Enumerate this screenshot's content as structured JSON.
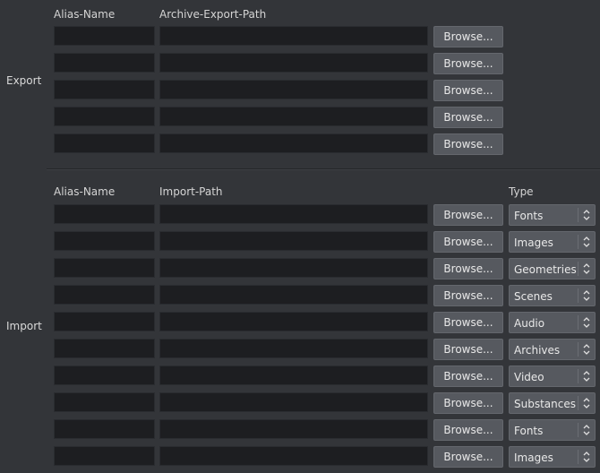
{
  "export": {
    "section_label": "Export",
    "headers": {
      "alias": "Alias-Name",
      "path": "Archive-Export-Path"
    },
    "rows": [
      {
        "alias": "",
        "path": "",
        "browse_label": "Browse..."
      },
      {
        "alias": "",
        "path": "",
        "browse_label": "Browse..."
      },
      {
        "alias": "",
        "path": "",
        "browse_label": "Browse..."
      },
      {
        "alias": "",
        "path": "",
        "browse_label": "Browse..."
      },
      {
        "alias": "",
        "path": "",
        "browse_label": "Browse..."
      }
    ]
  },
  "import": {
    "section_label": "Import",
    "headers": {
      "alias": "Alias-Name",
      "path": "Import-Path",
      "type": "Type"
    },
    "rows": [
      {
        "alias": "",
        "path": "",
        "browse_label": "Browse...",
        "type": "Fonts"
      },
      {
        "alias": "",
        "path": "",
        "browse_label": "Browse...",
        "type": "Images"
      },
      {
        "alias": "",
        "path": "",
        "browse_label": "Browse...",
        "type": "Geometries"
      },
      {
        "alias": "",
        "path": "",
        "browse_label": "Browse...",
        "type": "Scenes"
      },
      {
        "alias": "",
        "path": "",
        "browse_label": "Browse...",
        "type": "Audio"
      },
      {
        "alias": "",
        "path": "",
        "browse_label": "Browse...",
        "type": "Archives"
      },
      {
        "alias": "",
        "path": "",
        "browse_label": "Browse...",
        "type": "Video"
      },
      {
        "alias": "",
        "path": "",
        "browse_label": "Browse...",
        "type": "Substances"
      },
      {
        "alias": "",
        "path": "",
        "browse_label": "Browse...",
        "type": "Fonts"
      },
      {
        "alias": "",
        "path": "",
        "browse_label": "Browse...",
        "type": "Images"
      }
    ]
  },
  "colors": {
    "background": "#333539",
    "field_bg": "#1d1e21",
    "button_bg": "#56595f"
  }
}
